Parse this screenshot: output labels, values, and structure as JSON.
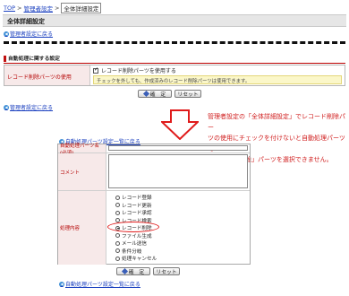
{
  "breadcrumb": {
    "items": [
      "TOP",
      "管理者設定"
    ],
    "current": "全体詳細設定",
    "separator": ">"
  },
  "title": "全体詳細設定",
  "back_link_top": "管理者設定に戻る",
  "back_link_bottom": "管理者設定に戻る",
  "section": {
    "heading": "自動処理に関する設定",
    "label": "レコード削除パーツの使用",
    "checkbox_label": "レコード削除パーツを使用する",
    "checkbox_checked": true,
    "note": "チェックを外しても、作成済みのレコード削除パーツは使用できます。"
  },
  "buttons": {
    "confirm": "確　定",
    "reset": "リセット"
  },
  "callout": {
    "lines": [
      "管理者設定の「全体詳細設定」でレコード削除パー",
      "ツの使用にチェックを付けないと自動処理パーツで",
      "「レコード削除」パーツを選択できません。"
    ]
  },
  "parts_form": {
    "link_top": "自動処理パーツ設定一覧に戻る",
    "link_bottom": "自動処理パーツ設定一覧に戻る",
    "name_label": "自動処理パーツ名(必須)",
    "comment_label": "コメント",
    "process_label": "処理内容",
    "options": [
      "レコード登録",
      "レコード更新",
      "レコード承認",
      "レコード検索",
      "レコード削除",
      "ファイル生成",
      "メール送信",
      "条件分岐",
      "処理キャンセル"
    ],
    "selected": "レコード削除"
  },
  "colors": {
    "accent_red": "#d01d1d",
    "link_blue": "#1a3fbf",
    "label_bg": "#f7e9e9"
  }
}
